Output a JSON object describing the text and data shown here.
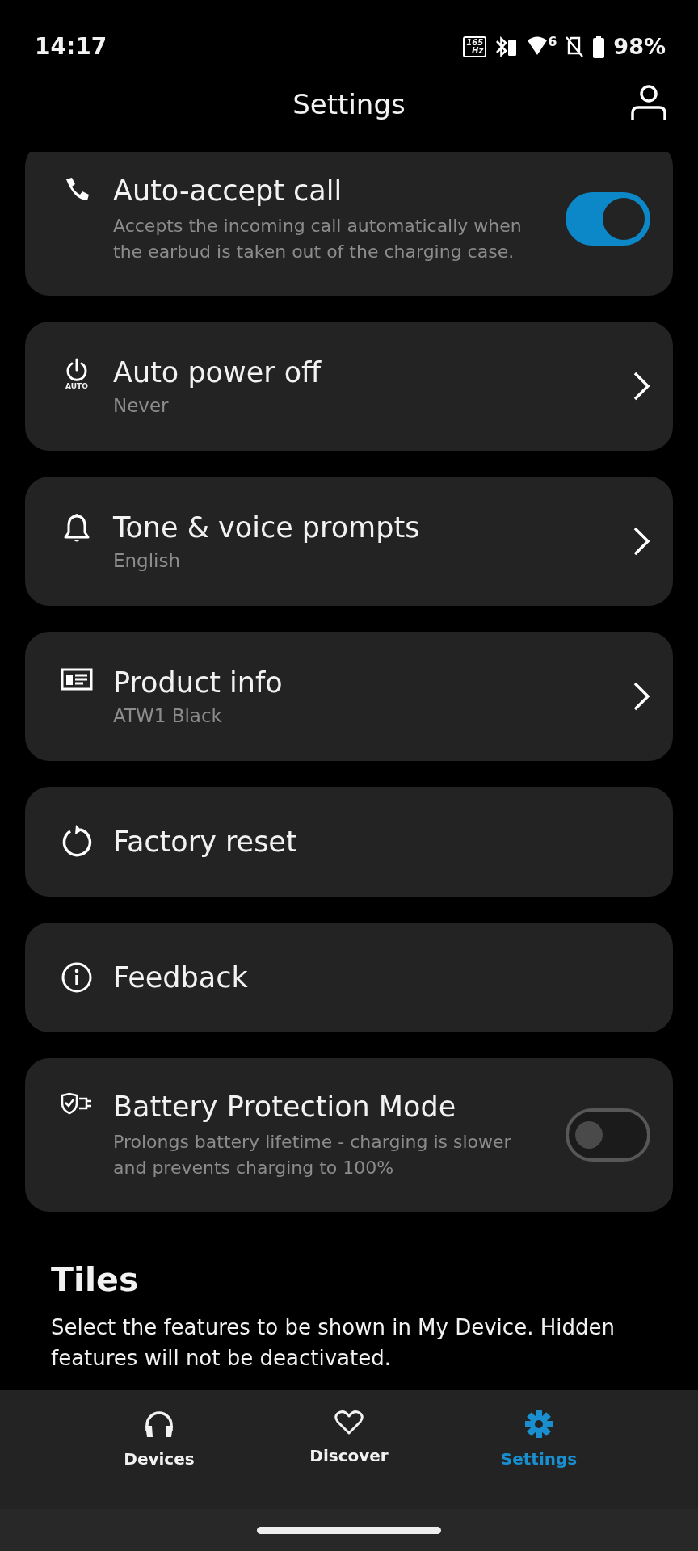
{
  "status_bar": {
    "time": "14:17",
    "refresh_rate": "165",
    "refresh_unit": "Hz",
    "wifi_badge": "6",
    "battery": "98%"
  },
  "header": {
    "title": "Settings"
  },
  "settings": [
    {
      "kind": "toggle",
      "title": "Auto-accept call",
      "description": "Accepts the incoming call automatically when the earbud is taken out of the charging case.",
      "on": true
    },
    {
      "kind": "link",
      "icon_label": "AUTO",
      "title": "Auto power off",
      "value": "Never"
    },
    {
      "kind": "link",
      "title": "Tone & voice prompts",
      "value": "English"
    },
    {
      "kind": "link",
      "title": "Product info",
      "value": "ATW1 Black"
    },
    {
      "kind": "action",
      "title": "Factory reset"
    },
    {
      "kind": "action",
      "title": "Feedback"
    },
    {
      "kind": "toggle",
      "title": "Battery Protection Mode",
      "description": "Prolongs battery lifetime - charging is slower and prevents charging to 100%",
      "on": false
    }
  ],
  "tiles": {
    "title": "Tiles",
    "description": "Select the features to be shown in My Device. Hidden features will not be deactivated."
  },
  "nav": [
    {
      "label": "Devices",
      "selected": false
    },
    {
      "label": "Discover",
      "selected": false
    },
    {
      "label": "Settings",
      "selected": true
    }
  ]
}
